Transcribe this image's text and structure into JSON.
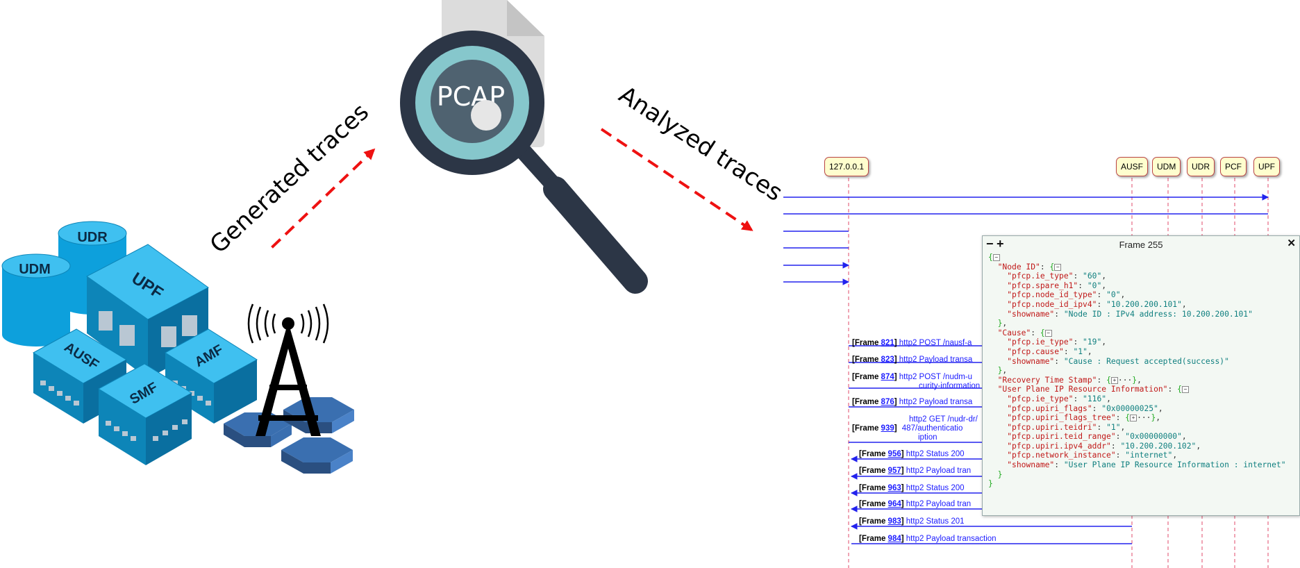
{
  "labels": {
    "generated": "Generated traces",
    "analyzed": "Analyzed traces",
    "pcap": "PCAP"
  },
  "network_functions": [
    "UDR",
    "UDM",
    "UPF",
    "AUSF",
    "AMF",
    "SMF"
  ],
  "sequence": {
    "participants": [
      "127.0.0.1",
      "AUSF",
      "UDM",
      "UDR",
      "PCF",
      "UPF"
    ],
    "messages": [
      {
        "frame": "821",
        "text": "http2 POST /nausf-a"
      },
      {
        "frame": "823",
        "text": "http2 Payload transa"
      },
      {
        "frame": "874",
        "text": "http2 POST /nudm-u",
        "text2": "curity-information"
      },
      {
        "frame": "876",
        "text": "http2 Payload transa"
      },
      {
        "frame": "939",
        "text": "http2 GET /nudr-dr/",
        "text2": "487/authenticatio",
        "text3": "iption"
      },
      {
        "frame": "956",
        "text": "http2 Status 200"
      },
      {
        "frame": "957",
        "text": "http2 Payload tran"
      },
      {
        "frame": "963",
        "text": "http2 Status 200"
      },
      {
        "frame": "964",
        "text": "http2 Payload tran"
      },
      {
        "frame": "983",
        "text": "http2 Status 201"
      },
      {
        "frame": "984",
        "text": "http2 Payload transaction"
      }
    ]
  },
  "popup": {
    "title": "Frame 255",
    "minus": "−",
    "plus": "+",
    "close": "✕",
    "node_id": {
      "key": "Node ID",
      "ie_type": "60",
      "spare_h1": "0",
      "node_id_type": "0",
      "node_id_ipv4": "10.200.200.101",
      "showname": "Node ID : IPv4 address: 10.200.200.101"
    },
    "cause": {
      "key": "Cause",
      "ie_type": "19",
      "cause": "1",
      "showname": "Cause : Request accepted(success)"
    },
    "recovery_key": "Recovery Time Stamp",
    "upiri": {
      "key": "User Plane IP Resource Information",
      "ie_type": "116",
      "flags": "0x00000025",
      "teidri": "1",
      "teid_range": "0x00000000",
      "ipv4_addr": "10.200.200.102",
      "network_instance": "internet",
      "showname": "User Plane IP Resource Information : internet"
    }
  },
  "colors": {
    "arrow_red": "#ee1111",
    "msg_blue": "#2222ee",
    "lifeline": "#e04a6a",
    "nf_cyan": "#1aa5e0",
    "lens_ring": "#2c3646",
    "lens_glass": "#86c7cc"
  }
}
